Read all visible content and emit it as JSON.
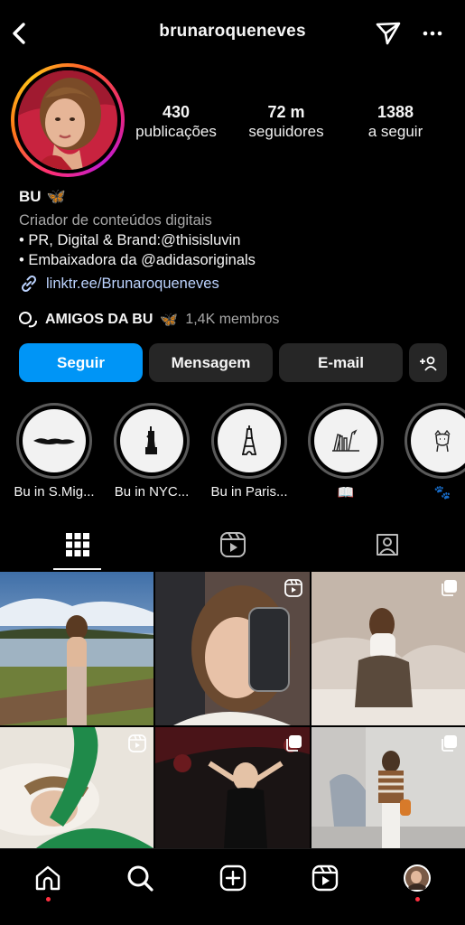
{
  "header": {
    "username": "brunaroqueneves"
  },
  "stats": [
    {
      "value": "430",
      "label": "publicações"
    },
    {
      "value": "72 m",
      "label": "seguidores"
    },
    {
      "value": "1388",
      "label": "a seguir"
    }
  ],
  "bio": {
    "name": "BU",
    "name_emoji": "🦋",
    "category": "Criador de conteúdos digitais",
    "line1": "• PR, Digital & Brand:@thisisluvin",
    "line2": "• Embaixadora da @adidasoriginals",
    "link": "linktr.ee/Brunaroqueneves"
  },
  "community": {
    "title": "AMIGOS DA BU",
    "emoji": "🦋",
    "members": "1,4K membros"
  },
  "actions": {
    "follow": "Seguir",
    "message": "Mensagem",
    "email": "E-mail"
  },
  "highlights": [
    {
      "label": "Bu in S.Mig...",
      "icon": "island-icon"
    },
    {
      "label": "Bu in NYC...",
      "icon": "statue-of-liberty-icon"
    },
    {
      "label": "Bu in Paris...",
      "icon": "eiffel-tower-icon"
    },
    {
      "label": "📖",
      "icon": "books-icon"
    },
    {
      "label": "🐾",
      "icon": "dog-icon"
    }
  ],
  "colors": {
    "primary": "#0095f6",
    "secondary_button": "#262626",
    "notification_dot": "#ff3040"
  }
}
